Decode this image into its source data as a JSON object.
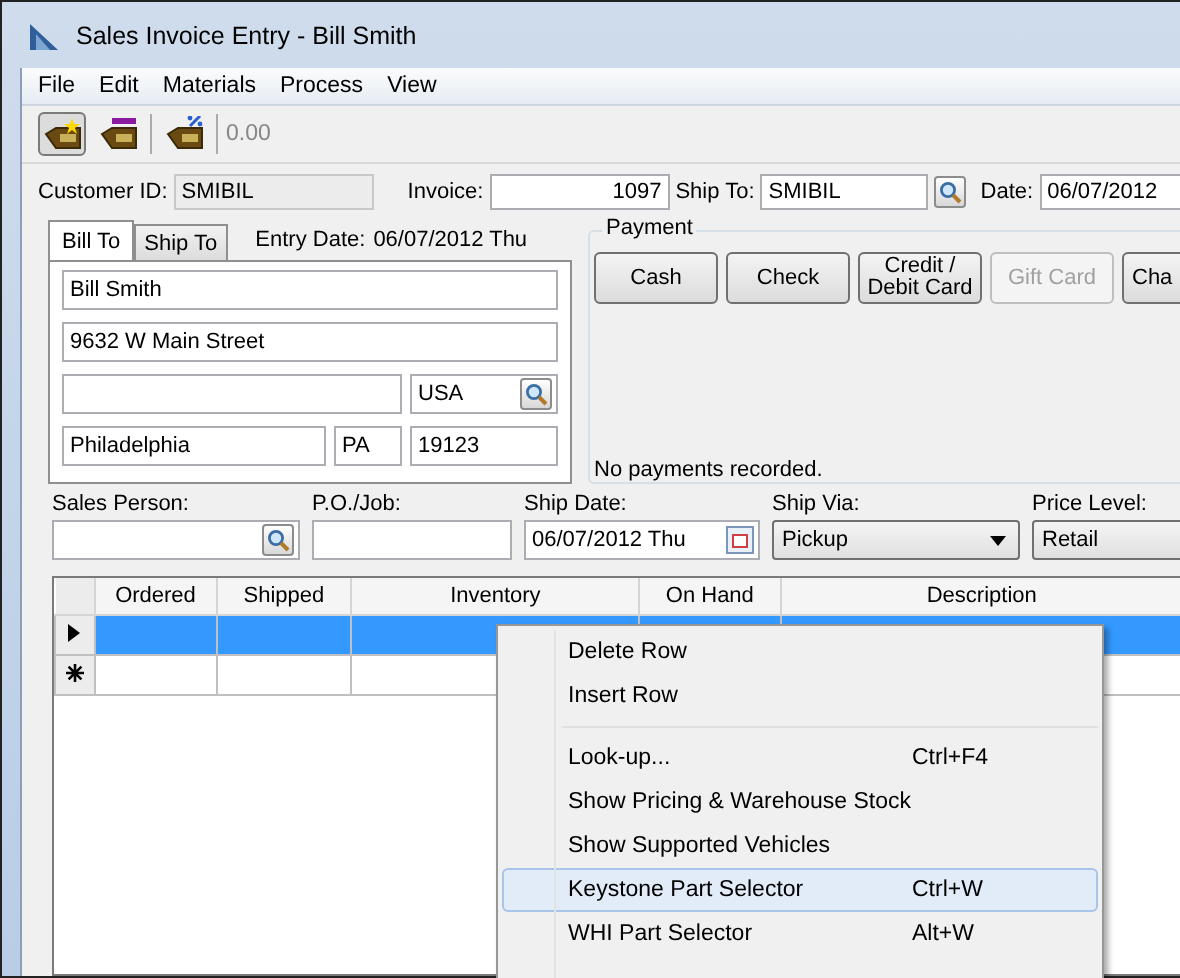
{
  "window": {
    "title": "Sales Invoice Entry - Bill Smith"
  },
  "menu": [
    {
      "label": "File"
    },
    {
      "label": "Edit"
    },
    {
      "label": "Materials"
    },
    {
      "label": "Process"
    },
    {
      "label": "View"
    }
  ],
  "toolbar": {
    "buttons": [
      {
        "kind": "new",
        "selected": true
      },
      {
        "kind": "level",
        "selected": false
      },
      {
        "kind": "discount",
        "selected": false
      }
    ],
    "total": "0.00"
  },
  "header": {
    "customer_id": {
      "label": "Customer ID:",
      "value": "SMIBIL"
    },
    "invoice": {
      "label": "Invoice:",
      "value": "1097"
    },
    "ship_to": {
      "label": "Ship To:",
      "value": "SMIBIL"
    },
    "date": {
      "label": "Date:",
      "value": "06/07/2012"
    }
  },
  "address_tabs": [
    {
      "label": "Bill To",
      "selected": true
    },
    {
      "label": "Ship To",
      "selected": false
    }
  ],
  "entry_date": {
    "label": "Entry Date:",
    "value": "06/07/2012 Thu"
  },
  "address": {
    "name": "Bill Smith",
    "street": "9632 W Main Street",
    "country": "USA",
    "city": "Philadelphia",
    "state": "PA",
    "zip": "19123"
  },
  "payment": {
    "title": "Payment",
    "buttons": [
      {
        "label": "Cash",
        "disabled": false
      },
      {
        "label": "Check",
        "disabled": false
      },
      {
        "label": "Credit / Debit Card",
        "disabled": false
      },
      {
        "label": "Gift Card",
        "disabled": true
      },
      {
        "label": "Cha",
        "disabled": false
      }
    ],
    "status": "No payments recorded."
  },
  "details": {
    "sales_person": {
      "label": "Sales Person:"
    },
    "po_job": {
      "label": "P.O./Job:"
    },
    "ship_date": {
      "label": "Ship Date:",
      "value": "06/07/2012 Thu"
    },
    "ship_via": {
      "label": "Ship Via:",
      "value": "Pickup"
    },
    "price_level": {
      "label": "Price Level:",
      "value": "Retail"
    }
  },
  "grid": {
    "columns": [
      "Ordered",
      "Shipped",
      "Inventory",
      "On Hand",
      "Description"
    ],
    "rows": [
      {
        "kind": "current",
        "selected": true
      },
      {
        "kind": "new",
        "selected": false
      }
    ]
  },
  "context_menu": {
    "items": [
      {
        "kind": "item",
        "label": "Delete Row",
        "selected": false
      },
      {
        "kind": "item",
        "label": "Insert Row",
        "selected": false
      },
      {
        "kind": "separator"
      },
      {
        "kind": "item",
        "label": "Look-up...",
        "shortcut": "Ctrl+F4",
        "selected": false
      },
      {
        "kind": "item",
        "label": "Show Pricing & Warehouse Stock",
        "selected": false
      },
      {
        "kind": "item",
        "label": "Show Supported Vehicles",
        "selected": false
      },
      {
        "kind": "item",
        "label": "Keystone Part Selector",
        "shortcut": "Ctrl+W",
        "selected": true
      },
      {
        "kind": "item",
        "label": "WHI Part Selector",
        "shortcut": "Alt+W",
        "selected": false
      }
    ]
  }
}
